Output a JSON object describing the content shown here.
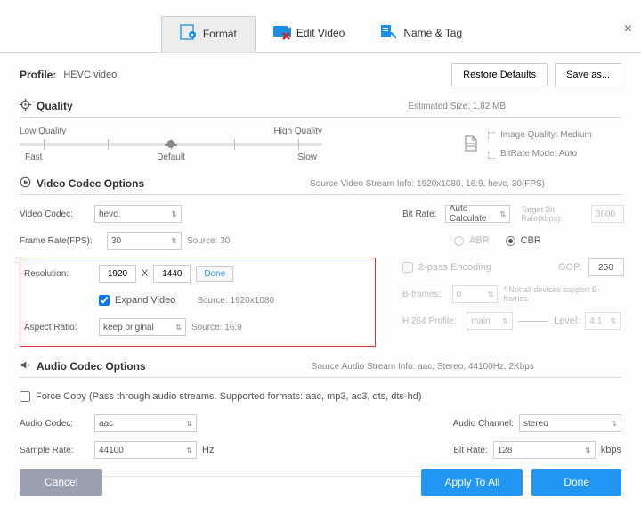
{
  "window": {
    "close": "×"
  },
  "tabs": {
    "format": "Format",
    "editVideo": "Edit Video",
    "nameTag": "Name & Tag"
  },
  "profile": {
    "label": "Profile:",
    "value": "HEVC video",
    "restore": "Restore Defaults",
    "saveAs": "Save as..."
  },
  "quality": {
    "title": "Quality",
    "estimated": "Estimated Size:  1.82 MB",
    "low": "Low Quality",
    "high": "High Quality",
    "fast": "Fast",
    "default": "Default",
    "slow": "Slow",
    "imageQuality": "Image Quality: Medium",
    "bitrateMode": "BitRate Mode: Auto"
  },
  "video": {
    "title": "Video Codec Options",
    "streamInfo": "Source Video Stream Info: 1920x1080, 16:9, hevc, 30(FPS)",
    "codecLabel": "Video Codec:",
    "codec": "hevc",
    "fpsLabel": "Frame Rate(FPS):",
    "fps": "30",
    "fpsSrc": "Source: 30",
    "resLabel": "Resolution:",
    "resW": "1920",
    "resX": "X",
    "resH": "1440",
    "done": "Done",
    "expand": "Expand Video",
    "resSrc": "Source: 1920x1080",
    "aspectLabel": "Aspect Ratio:",
    "aspect": "keep original",
    "aspectSrc": "Source: 16:9",
    "bitrateLabel": "Bit Rate:",
    "bitrate": "Auto Calculate",
    "targetLabel": "Target Bit Rate(kbps):",
    "target": "3600",
    "abr": "ABR",
    "cbr": "CBR",
    "twopass": "2-pass Encoding",
    "gopLabel": "GOP:",
    "gop": "250",
    "bframesLabel": "B-frames:",
    "bframes": "0",
    "bframesNote": "* Not all devices support B-frames",
    "profileLabel": "H.264 Profile:",
    "profile": "main",
    "levelLabel": "Level:",
    "level": "4.1"
  },
  "audio": {
    "title": "Audio Codec Options",
    "streamInfo": "Source Audio Stream Info: aac, Stereo, 44100Hz, 2Kbps",
    "forceCopy": "Force Copy (Pass through audio streams. Supported formats: aac, mp3, ac3, dts, dts-hd)",
    "codecLabel": "Audio Codec:",
    "codec": "aac",
    "sampleLabel": "Sample Rate:",
    "sample": "44100",
    "hz": "Hz",
    "channelLabel": "Audio Channel:",
    "channel": "stereo",
    "bitrateLabel": "Bit Rate:",
    "bitrate": "128",
    "kbps": "kbps"
  },
  "footer": {
    "cancel": "Cancel",
    "applyAll": "Apply To All",
    "done": "Done"
  }
}
